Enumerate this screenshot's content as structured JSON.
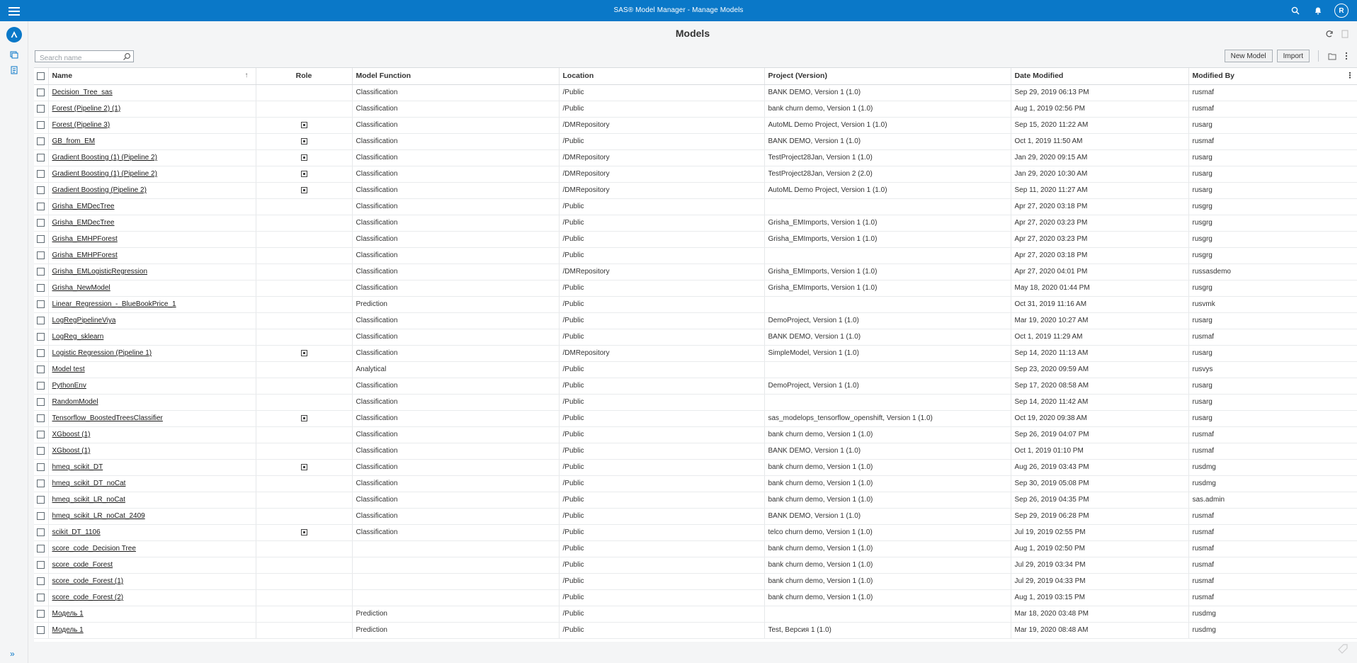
{
  "app": {
    "title": "SAS® Model Manager - Manage Models",
    "avatar_initial": "R"
  },
  "page": {
    "title": "Models"
  },
  "search": {
    "placeholder": "Search name"
  },
  "toolbar": {
    "new_model": "New Model",
    "import": "Import"
  },
  "columns": [
    "Name",
    "Role",
    "Model Function",
    "Location",
    "Project (Version)",
    "Date Modified",
    "Modified By"
  ],
  "rows": [
    {
      "name": "Decision_Tree_sas",
      "role": false,
      "function": "Classification",
      "location": "/Public",
      "project": "BANK DEMO, Version 1 (1.0)",
      "date": "Sep 29, 2019 06:13 PM",
      "by": "rusmaf"
    },
    {
      "name": "Forest (Pipeline 2) (1)",
      "role": false,
      "function": "Classification",
      "location": "/Public",
      "project": "bank churn demo, Version 1 (1.0)",
      "date": "Aug 1, 2019 02:56 PM",
      "by": "rusmaf"
    },
    {
      "name": "Forest (Pipeline 3)",
      "role": true,
      "function": "Classification",
      "location": "/DMRepository",
      "project": "AutoML Demo Project, Version 1 (1.0)",
      "date": "Sep 15, 2020 11:22 AM",
      "by": "rusarg"
    },
    {
      "name": "GB_from_EM",
      "role": true,
      "function": "Classification",
      "location": "/Public",
      "project": "BANK DEMO, Version 1 (1.0)",
      "date": "Oct 1, 2019 11:50 AM",
      "by": "rusmaf"
    },
    {
      "name": "Gradient Boosting (1) (Pipeline 2)",
      "role": true,
      "function": "Classification",
      "location": "/DMRepository",
      "project": "TestProject28Jan, Version 1 (1.0)",
      "date": "Jan 29, 2020 09:15 AM",
      "by": "rusarg"
    },
    {
      "name": "Gradient Boosting (1) (Pipeline 2)",
      "role": true,
      "function": "Classification",
      "location": "/DMRepository",
      "project": "TestProject28Jan, Version 2 (2.0)",
      "date": "Jan 29, 2020 10:30 AM",
      "by": "rusarg"
    },
    {
      "name": "Gradient Boosting (Pipeline 2)",
      "role": true,
      "function": "Classification",
      "location": "/DMRepository",
      "project": "AutoML Demo Project, Version 1 (1.0)",
      "date": "Sep 11, 2020 11:27 AM",
      "by": "rusarg"
    },
    {
      "name": "Grisha_EMDecTree",
      "role": false,
      "function": "Classification",
      "location": "/Public",
      "project": "",
      "date": "Apr 27, 2020 03:18 PM",
      "by": "rusgrg"
    },
    {
      "name": "Grisha_EMDecTree",
      "role": false,
      "function": "Classification",
      "location": "/Public",
      "project": "Grisha_EMImports, Version 1 (1.0)",
      "date": "Apr 27, 2020 03:23 PM",
      "by": "rusgrg"
    },
    {
      "name": "Grisha_EMHPForest",
      "role": false,
      "function": "Classification",
      "location": "/Public",
      "project": "Grisha_EMImports, Version 1 (1.0)",
      "date": "Apr 27, 2020 03:23 PM",
      "by": "rusgrg"
    },
    {
      "name": "Grisha_EMHPForest",
      "role": false,
      "function": "Classification",
      "location": "/Public",
      "project": "",
      "date": "Apr 27, 2020 03:18 PM",
      "by": "rusgrg"
    },
    {
      "name": "Grisha_EMLogisticRegression",
      "role": false,
      "function": "Classification",
      "location": "/DMRepository",
      "project": "Grisha_EMImports, Version 1 (1.0)",
      "date": "Apr 27, 2020 04:01 PM",
      "by": "russasdemo"
    },
    {
      "name": "Grisha_NewModel",
      "role": false,
      "function": "Classification",
      "location": "/Public",
      "project": "Grisha_EMImports, Version 1 (1.0)",
      "date": "May 18, 2020 01:44 PM",
      "by": "rusgrg"
    },
    {
      "name": "Linear_Regression_-_BlueBookPrice_1",
      "role": false,
      "function": "Prediction",
      "location": "/Public",
      "project": "",
      "date": "Oct 31, 2019 11:16 AM",
      "by": "rusvmk"
    },
    {
      "name": "LogRegPipelineViya",
      "role": false,
      "function": "Classification",
      "location": "/Public",
      "project": "DemoProject, Version 1 (1.0)",
      "date": "Mar 19, 2020 10:27 AM",
      "by": "rusarg"
    },
    {
      "name": "LogReg_sklearn",
      "role": false,
      "function": "Classification",
      "location": "/Public",
      "project": "BANK DEMO, Version 1 (1.0)",
      "date": "Oct 1, 2019 11:29 AM",
      "by": "rusmaf"
    },
    {
      "name": "Logistic Regression (Pipeline 1)",
      "role": true,
      "function": "Classification",
      "location": "/DMRepository",
      "project": "SimpleModel, Version 1 (1.0)",
      "date": "Sep 14, 2020 11:13 AM",
      "by": "rusarg"
    },
    {
      "name": "Model test",
      "role": false,
      "function": "Analytical",
      "location": "/Public",
      "project": "",
      "date": "Sep 23, 2020 09:59 AM",
      "by": "rusvys"
    },
    {
      "name": "PythonEnv",
      "role": false,
      "function": "Classification",
      "location": "/Public",
      "project": "DemoProject, Version 1 (1.0)",
      "date": "Sep 17, 2020 08:58 AM",
      "by": "rusarg"
    },
    {
      "name": "RandomModel",
      "role": false,
      "function": "Classification",
      "location": "/Public",
      "project": "",
      "date": "Sep 14, 2020 11:42 AM",
      "by": "rusarg"
    },
    {
      "name": "Tensorflow_BoostedTreesClassifier",
      "role": true,
      "function": "Classification",
      "location": "/Public",
      "project": "sas_modelops_tensorflow_openshift, Version 1 (1.0)",
      "date": "Oct 19, 2020 09:38 AM",
      "by": "rusarg"
    },
    {
      "name": "XGboost (1)",
      "role": false,
      "function": "Classification",
      "location": "/Public",
      "project": "bank churn demo, Version 1 (1.0)",
      "date": "Sep 26, 2019 04:07 PM",
      "by": "rusmaf"
    },
    {
      "name": "XGboost (1)",
      "role": false,
      "function": "Classification",
      "location": "/Public",
      "project": "BANK DEMO, Version 1 (1.0)",
      "date": "Oct 1, 2019 01:10 PM",
      "by": "rusmaf"
    },
    {
      "name": "hmeq_scikit_DT",
      "role": true,
      "function": "Classification",
      "location": "/Public",
      "project": "bank churn demo, Version 1 (1.0)",
      "date": "Aug 26, 2019 03:43 PM",
      "by": "rusdmg"
    },
    {
      "name": "hmeq_scikit_DT_noCat",
      "role": false,
      "function": "Classification",
      "location": "/Public",
      "project": "bank churn demo, Version 1 (1.0)",
      "date": "Sep 30, 2019 05:08 PM",
      "by": "rusdmg"
    },
    {
      "name": "hmeq_scikit_LR_noCat",
      "role": false,
      "function": "Classification",
      "location": "/Public",
      "project": "bank churn demo, Version 1 (1.0)",
      "date": "Sep 26, 2019 04:35 PM",
      "by": "sas.admin"
    },
    {
      "name": "hmeq_scikit_LR_noCat_2409",
      "role": false,
      "function": "Classification",
      "location": "/Public",
      "project": "BANK DEMO, Version 1 (1.0)",
      "date": "Sep 29, 2019 06:28 PM",
      "by": "rusmaf"
    },
    {
      "name": "scikit_DT_1106",
      "role": true,
      "function": "Classification",
      "location": "/Public",
      "project": "telco churn demo, Version 1 (1.0)",
      "date": "Jul 19, 2019 02:55 PM",
      "by": "rusmaf"
    },
    {
      "name": "score_code_Decision Tree",
      "role": false,
      "function": "",
      "location": "/Public",
      "project": "bank churn demo, Version 1 (1.0)",
      "date": "Aug 1, 2019 02:50 PM",
      "by": "rusmaf"
    },
    {
      "name": "score_code_Forest",
      "role": false,
      "function": "",
      "location": "/Public",
      "project": "bank churn demo, Version 1 (1.0)",
      "date": "Jul 29, 2019 03:34 PM",
      "by": "rusmaf"
    },
    {
      "name": "score_code_Forest (1)",
      "role": false,
      "function": "",
      "location": "/Public",
      "project": "bank churn demo, Version 1 (1.0)",
      "date": "Jul 29, 2019 04:33 PM",
      "by": "rusmaf"
    },
    {
      "name": "score_code_Forest (2)",
      "role": false,
      "function": "",
      "location": "/Public",
      "project": "bank churn demo, Version 1 (1.0)",
      "date": "Aug 1, 2019 03:15 PM",
      "by": "rusmaf"
    },
    {
      "name": "Модель 1",
      "role": false,
      "function": "Prediction",
      "location": "/Public",
      "project": "",
      "date": "Mar 18, 2020 03:48 PM",
      "by": "rusdmg"
    },
    {
      "name": "Модель 1",
      "role": false,
      "function": "Prediction",
      "location": "/Public",
      "project": "Test, Версия 1 (1.0)",
      "date": "Mar 19, 2020 08:48 AM",
      "by": "rusdmg"
    }
  ],
  "colors": {
    "appbar": "#0a78c8",
    "background": "#f4f5f6"
  }
}
